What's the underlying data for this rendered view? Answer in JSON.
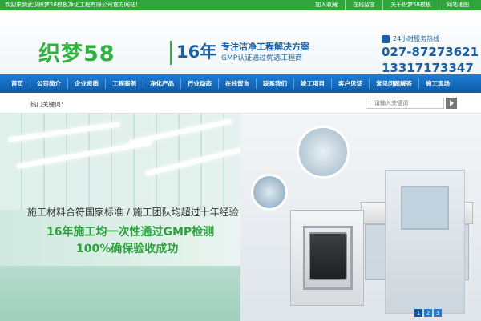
{
  "topbar": {
    "welcome": "欢迎来到武汉织梦58模板净化工程有限公司官方网站！",
    "links": [
      "加入收藏",
      "在线留言",
      "关于织梦58模板",
      "网站地图"
    ]
  },
  "header": {
    "logo": "织梦58",
    "years": "16年",
    "slogan_line1": "专注洁净工程解决方案",
    "slogan_line2": "GMP认证通过优选工程商",
    "hotline_label": "24小时服务热线",
    "phone1": "027-87273621",
    "phone2": "13317173347"
  },
  "nav": {
    "items": [
      "首页",
      "公司简介",
      "企业资质",
      "工程案例",
      "净化产品",
      "行业动态",
      "在线留言",
      "联系我们",
      "竣工项目",
      "客户见证",
      "常见问题解答",
      "施工现场"
    ]
  },
  "search": {
    "hot_label": "热门关键词：",
    "placeholder": "请输入关键词"
  },
  "banner": {
    "line1": "施工材料合符国家标准 / 施工团队均超过十年经验",
    "line2": "16年施工均一次性通过GMP检测",
    "line3": "100%确保验收成功",
    "pager": [
      "1",
      "2",
      "3"
    ]
  },
  "colors": {
    "brand_green": "#2db43d",
    "nav_blue": "#1c7ed6",
    "text_blue": "#1b5fa6"
  }
}
